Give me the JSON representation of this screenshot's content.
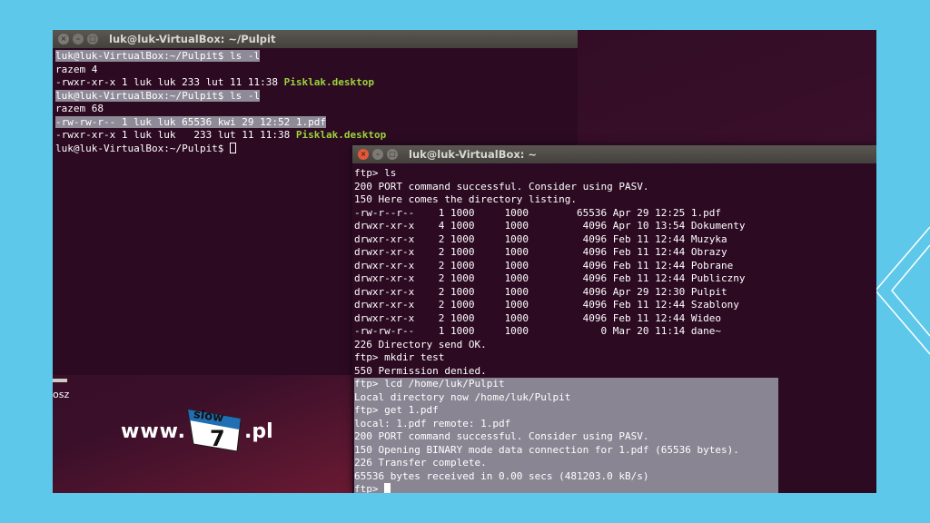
{
  "window1": {
    "title": "luk@luk-VirtualBox: ~/Pulpit",
    "lines": [
      {
        "pre": "luk@luk-VirtualBox:~/Pulpit$ ls -l",
        "hl": true
      },
      {
        "pre": "razem 4"
      },
      {
        "pre": "-rwxr-xr-x 1 luk luk 233 lut 11 11:38 ",
        "green": "Pisklak.desktop"
      },
      {
        "pre": "luk@luk-VirtualBox:~/Pulpit$ ls -l",
        "hl": true
      },
      {
        "pre": "razem 68"
      },
      {
        "pre": "-rw-rw-r-- 1 luk luk 65536 kwi 29 12:52 1.pdf",
        "hl": true
      },
      {
        "pre": "-rwxr-xr-x 1 luk luk   233 lut 11 11:38 ",
        "green": "Pisklak.desktop"
      },
      {
        "pre": "luk@luk-VirtualBox:~/Pulpit$ ",
        "cursor": true
      }
    ]
  },
  "window2": {
    "title": "luk@luk-VirtualBox: ~",
    "lines": [
      "ftp> ls",
      "200 PORT command successful. Consider using PASV.",
      "150 Here comes the directory listing.",
      "-rw-r--r--    1 1000     1000        65536 Apr 29 12:25 1.pdf",
      "drwxr-xr-x    4 1000     1000         4096 Apr 10 13:54 Dokumenty",
      "drwxr-xr-x    2 1000     1000         4096 Feb 11 12:44 Muzyka",
      "drwxr-xr-x    2 1000     1000         4096 Feb 11 12:44 Obrazy",
      "drwxr-xr-x    2 1000     1000         4096 Feb 11 12:44 Pobrane",
      "drwxr-xr-x    2 1000     1000         4096 Feb 11 12:44 Publiczny",
      "drwxr-xr-x    2 1000     1000         4096 Apr 29 12:30 Pulpit",
      "drwxr-xr-x    2 1000     1000         4096 Feb 11 12:44 Szablony",
      "drwxr-xr-x    2 1000     1000         4096 Feb 11 12:44 Wideo",
      "-rw-rw-r--    1 1000     1000            0 Mar 20 11:14 dane~",
      "226 Directory send OK.",
      "ftp> mkdir test",
      "550 Permission denied."
    ],
    "highlighted_lines": [
      "ftp> lcd /home/luk/Pulpit",
      "Local directory now /home/luk/Pulpit",
      "ftp> get 1.pdf",
      "local: 1.pdf remote: 1.pdf",
      "200 PORT command successful. Consider using PASV.",
      "150 Opening BINARY mode data connection for 1.pdf (65536 bytes).",
      "226 Transfer complete.",
      "65536 bytes received in 0.00 secs (481203.0 kB/s)"
    ],
    "prompt": "ftp> "
  },
  "desktop": {
    "icon_label": "osz"
  },
  "logo": {
    "www": "www.",
    "slow": "slow",
    "seven": "7",
    "pl": ".pl"
  },
  "colors": {
    "terminal_bg": "#2c0a22",
    "green": "#9bd33c",
    "selection": "#8f8a97",
    "slide_bg": "#5ec8ea"
  }
}
